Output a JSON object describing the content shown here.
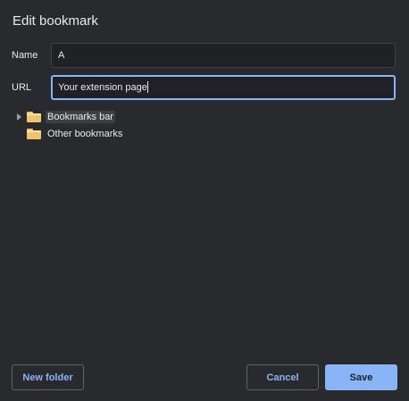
{
  "dialog": {
    "title": "Edit bookmark",
    "name_label": "Name",
    "name_value": "A",
    "url_label": "URL",
    "url_value": "Your extension page"
  },
  "tree": {
    "items": [
      {
        "label": "Bookmarks bar",
        "expandable": true,
        "selected": true,
        "icon": "folder-icon"
      },
      {
        "label": "Other bookmarks",
        "expandable": false,
        "selected": false,
        "icon": "folder-icon"
      }
    ]
  },
  "buttons": {
    "new_folder": "New folder",
    "cancel": "Cancel",
    "save": "Save"
  },
  "colors": {
    "background": "#292a2d",
    "accent": "#8ab4f8",
    "folder": "#f2c46a"
  }
}
